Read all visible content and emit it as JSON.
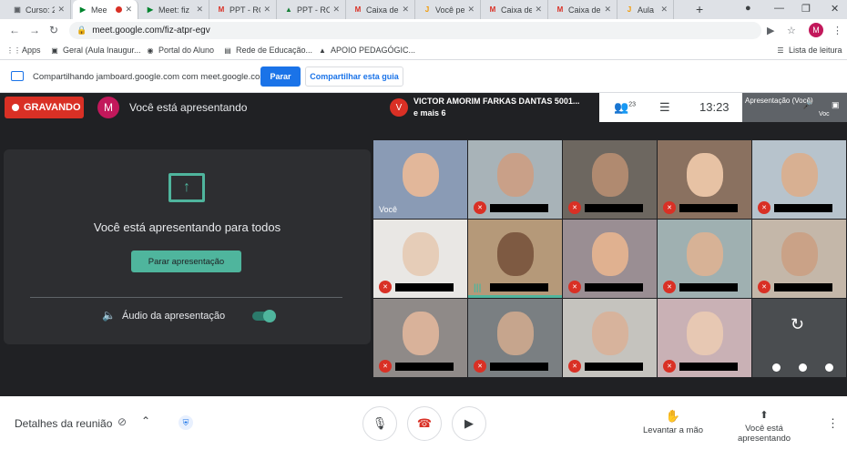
{
  "tabs": [
    {
      "label": "Curso: 2",
      "icon": "classroom-icon",
      "color": "#5f6368"
    },
    {
      "label": "Mee",
      "icon": "meet-icon",
      "color": "#00832d",
      "active": true,
      "recording": true
    },
    {
      "label": "Meet: fiz",
      "icon": "meet-icon",
      "color": "#00832d"
    },
    {
      "label": "PPT - RO",
      "icon": "gmail-icon",
      "color": "#d93025"
    },
    {
      "label": "PPT - RO",
      "icon": "drive-icon",
      "color": "#188038"
    },
    {
      "label": "Caixa de",
      "icon": "gmail-icon",
      "color": "#d93025"
    },
    {
      "label": "Você pe",
      "icon": "jamboard-icon",
      "color": "#f29900"
    },
    {
      "label": "Caixa de",
      "icon": "gmail-icon",
      "color": "#d93025"
    },
    {
      "label": "Caixa de",
      "icon": "gmail-icon",
      "color": "#d93025"
    },
    {
      "label": "Aula",
      "icon": "jamboard-icon",
      "color": "#f29900"
    }
  ],
  "address": {
    "url": "meet.google.com/fiz-atpr-egv",
    "profile_initial": "M"
  },
  "bookmarks": [
    {
      "label": "Apps",
      "icon": "apps-grid-icon"
    },
    {
      "label": "Geral (Aula Inaugur...",
      "icon": "teams-icon"
    },
    {
      "label": "Portal do Aluno",
      "icon": "portal-icon"
    },
    {
      "label": "Rede de Educação...",
      "icon": "rede-icon"
    },
    {
      "label": "APOIO PEDAGÓGIC...",
      "icon": "drive-icon"
    }
  ],
  "reading_list": "Lista de leitura",
  "share": {
    "text": "Compartilhando jamboard.google.com com meet.google.com",
    "stop": "Parar",
    "share_tab": "Compartilhar esta guia"
  },
  "meet": {
    "recording": "GRAVANDO",
    "presenter_initial": "M",
    "presenter_status": "Você está apresentando",
    "host_initial": "V",
    "host_name": "VICTOR AMORIM FARKAS DANTAS 5001...",
    "host_more": "e mais 6",
    "people_count": "23",
    "time": "13:23",
    "self_label": "Apresentação (Você)",
    "self_extra": "Voc"
  },
  "card": {
    "title": "Você está apresentando para todos",
    "stop_button": "Parar apresentação",
    "audio_label": "Áudio da apresentação"
  },
  "tiles": [
    {
      "label": "Você",
      "bg": "#8a9bb5",
      "face": "#e2b79a",
      "self": true
    },
    {
      "bg": "#a8b3b8",
      "face": "#c9a088"
    },
    {
      "bg": "#6d6760",
      "face": "#b08a70"
    },
    {
      "bg": "#8a7160",
      "face": "#e7c2a4"
    },
    {
      "bg": "#b7c3cc",
      "face": "#d8b092"
    },
    {
      "bg": "#e9e7e4",
      "face": "#e6cdb8"
    },
    {
      "bg": "#b59979",
      "face": "#7e5a42",
      "speaking": true
    },
    {
      "bg": "#9a8e93",
      "face": "#e0b190"
    },
    {
      "bg": "#9fb0b1",
      "face": "#d7b296"
    },
    {
      "bg": "#c4b7a9",
      "face": "#caa287"
    },
    {
      "bg": "#8f8a88",
      "face": "#d9b29a"
    },
    {
      "bg": "#7a7f82",
      "face": "#c6a58d"
    },
    {
      "bg": "#c5c3be",
      "face": "#d7b39c"
    },
    {
      "bg": "#c9b1b5",
      "face": "#e7c8b3"
    },
    {
      "bg": "#4a4d50",
      "loading": true
    }
  ],
  "bottom": {
    "details": "Detalhes da reunião",
    "raise_hand": "Levantar a mão",
    "presenting": "Você está apresentando"
  }
}
